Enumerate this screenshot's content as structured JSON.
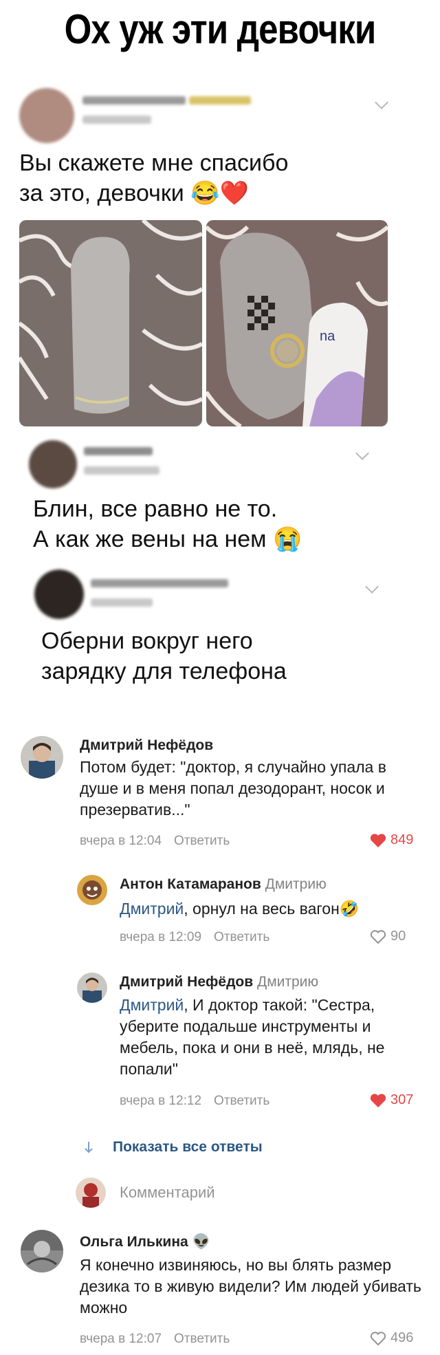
{
  "meme_title": "Ох уж эти девочки",
  "posts": [
    {
      "text": "Вы скажете мне спасибо\nза это, девочки 😂❤️"
    },
    {
      "text": "Блин, все равно не то.\nА как же вены на нем 😭"
    },
    {
      "text": "Оберни вокруг него\nзарядку для телефона"
    }
  ],
  "comments": [
    {
      "name": "Дмитрий Нефёдов",
      "reply_to": "",
      "mention": "",
      "text": "Потом будет: \"доктор, я случайно упала в душе и в меня попал дезодорант, носок и презерватив...\"",
      "time": "вчера в 12:04",
      "answer": "Ответить",
      "likes": "849",
      "liked": true
    },
    {
      "name": "Антон Катамаранов",
      "reply_to": "Дмитрию",
      "mention": "Дмитрий",
      "text": ", орнул на весь вагон🤣",
      "time": "вчера в 12:09",
      "answer": "Ответить",
      "likes": "90",
      "liked": false
    },
    {
      "name": "Дмитрий Нефёдов",
      "reply_to": "Дмитрию",
      "mention": "Дмитрий",
      "text": ", И доктор такой: \"Сестра, уберите подальше инструменты и мебель, пока и они в неё, млядь, не попали\"",
      "time": "вчера в 12:12",
      "answer": "Ответить",
      "likes": "307",
      "liked": true
    },
    {
      "name": "Ольга Илькина 👽",
      "reply_to": "",
      "mention": "",
      "text": "Я конечно извиняюсь, но вы блять размер дезика то в живую видели? Им людей убивать можно",
      "time": "вчера в 12:07",
      "answer": "Ответить",
      "likes": "496",
      "liked": false
    }
  ],
  "show_all_replies": "Показать все ответы",
  "comment_placeholder": "Комментарий",
  "icons": {
    "heart_active": "heart-filled-icon",
    "heart_inactive": "heart-outline-icon",
    "arrow_down": "arrow-down-icon"
  },
  "colors": {
    "like_red": "#e64646",
    "link_blue": "#2a5885",
    "meta_gray": "#939393"
  }
}
